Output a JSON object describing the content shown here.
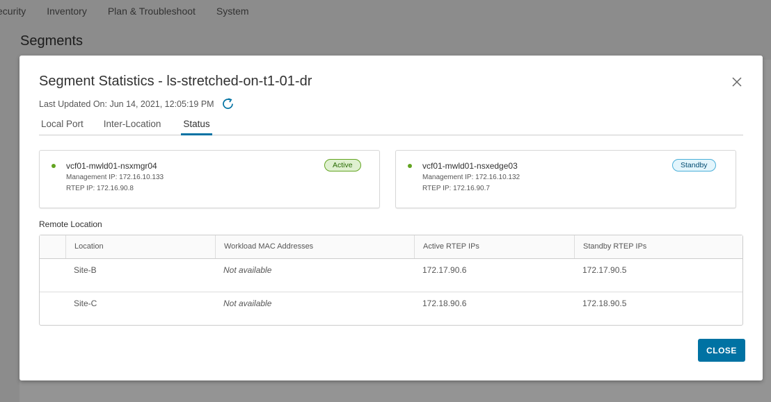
{
  "background": {
    "nav_items": [
      "ecurity",
      "Inventory",
      "Plan & Troubleshoot",
      "System"
    ],
    "page_title": "Segments"
  },
  "modal": {
    "title": "Segment Statistics - ls-stretched-on-t1-01-dr",
    "last_updated": "Last Updated On: Jun 14, 2021, 12:05:19 PM",
    "tabs": [
      {
        "label": "Local Port",
        "active": false
      },
      {
        "label": "Inter-Location",
        "active": false
      },
      {
        "label": "Status",
        "active": true
      }
    ],
    "cards": [
      {
        "name": "vcf01-mwld01-nsxmgr04",
        "management_ip": "Management IP: 172.16.10.133",
        "rtep_ip": "RTEP IP: 172.16.90.8",
        "status": "Active"
      },
      {
        "name": "vcf01-mwld01-nsxedge03",
        "management_ip": "Management IP: 172.16.10.132",
        "rtep_ip": "RTEP IP: 172.16.90.7",
        "status": "Standby"
      }
    ],
    "remote_location_label": "Remote Location",
    "table": {
      "columns": [
        "Location",
        "Workload MAC Addresses",
        "Active RTEP IPs",
        "Standby RTEP IPs"
      ],
      "rows": [
        {
          "location": "Site-B",
          "mac": "Not available",
          "active": "172.17.90.6",
          "standby": "172.17.90.5"
        },
        {
          "location": "Site-C",
          "mac": "Not available",
          "active": "172.18.90.6",
          "standby": "172.18.90.5"
        }
      ]
    },
    "close_label": "CLOSE"
  },
  "colors": {
    "primary": "#0072a3",
    "active_dot": "#62a420",
    "active_badge": "#dff0d0",
    "standby_badge": "#e3f5fc"
  },
  "icons": {
    "close": "close-icon",
    "refresh": "refresh-icon"
  }
}
